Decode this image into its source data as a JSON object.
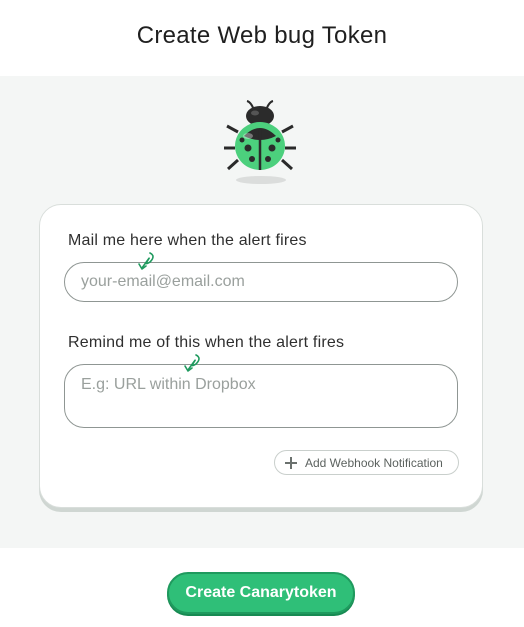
{
  "page": {
    "title": "Create Web bug Token"
  },
  "form": {
    "email_label": "Mail me here when the alert fires",
    "email_placeholder": "your-email@email.com",
    "email_value": "",
    "memo_label": "Remind me of this when the alert fires",
    "memo_placeholder": "E.g: URL within Dropbox",
    "memo_value": "",
    "webhook_label": "Add Webhook Notification",
    "webhook_icon": "plus-icon"
  },
  "footer": {
    "submit_label": "Create Canarytoken"
  },
  "icons": {
    "token_icon": "ladybug-icon",
    "hint_icon": "curly-arrow-icon"
  },
  "colors": {
    "accent": "#2fbf78",
    "accent_border": "#1f9a5e",
    "bug_green": "#4cd07d",
    "panel_bg": "#f4f6f5"
  }
}
